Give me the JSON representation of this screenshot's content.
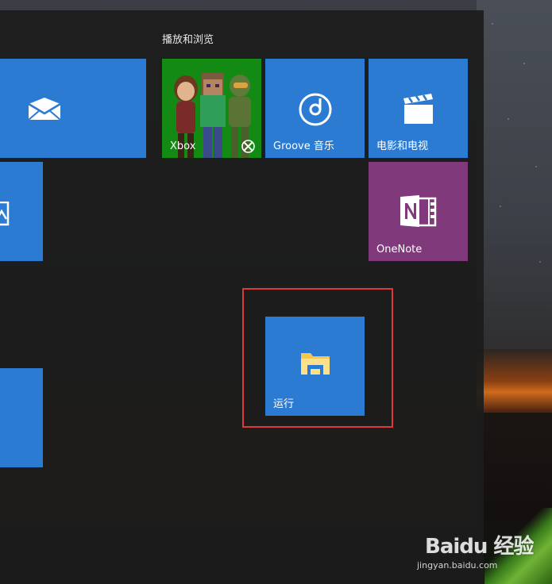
{
  "start_menu": {
    "group_title": "播放和浏览",
    "tiles": {
      "mail": {
        "label": "",
        "icon": "mail-icon",
        "color": "#2b7bd3"
      },
      "photos": {
        "label": "",
        "icon": "photos-icon",
        "color": "#2b7bd3"
      },
      "left_tile_3": {
        "label": "",
        "color": "#2b7bd3"
      },
      "xbox": {
        "label": "Xbox",
        "icon": "xbox-logo-icon",
        "color": "#138a13"
      },
      "groove": {
        "label": "Groove 音乐",
        "icon": "groove-music-icon",
        "color": "#2b7bd3"
      },
      "movies": {
        "label": "电影和电视",
        "icon": "clapperboard-icon",
        "color": "#2b7bd3"
      },
      "onenote": {
        "label": "OneNote",
        "icon": "onenote-icon",
        "color": "#80397b"
      },
      "run": {
        "label": "运行",
        "icon": "folder-icon",
        "color": "#2b7bd3"
      }
    },
    "highlight_color": "#e0383a"
  },
  "watermark": {
    "brand": "Baidu 经验",
    "url": "jingyan.baidu.com"
  }
}
